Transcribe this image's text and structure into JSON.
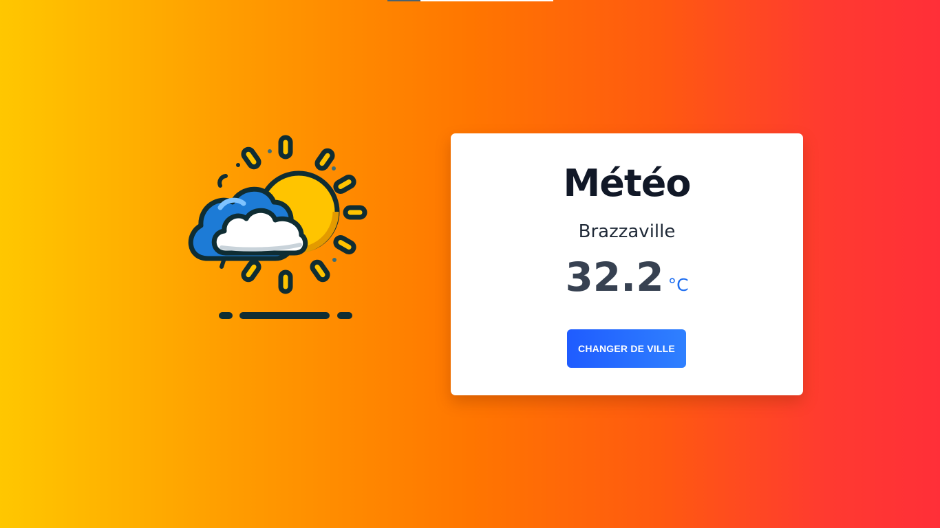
{
  "app": {
    "title": "Météo"
  },
  "weather": {
    "city": "Brazzaville",
    "temperature": "32.2",
    "unit": "°C",
    "icon": "partly-cloudy-sun-icon"
  },
  "actions": {
    "change_city_label": "CHANGER DE VILLE"
  },
  "colors": {
    "background_start": "#ffc700",
    "background_mid": "#ff7600",
    "background_end": "#ff2f38",
    "button": "#1f5cff",
    "unit_accent": "#1d6df0"
  }
}
